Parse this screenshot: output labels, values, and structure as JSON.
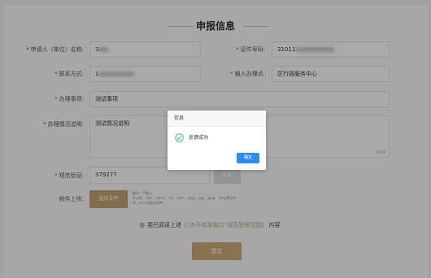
{
  "page": {
    "title": "申报信息"
  },
  "form": {
    "applicant": {
      "label": "申请人（单位）名称:",
      "value": "3"
    },
    "cert_no": {
      "label": "证件号码:",
      "value": "31011"
    },
    "contact": {
      "label": "联系方式:",
      "value": "1"
    },
    "location": {
      "label": "输入办理点:",
      "value": "区行政服务中心"
    },
    "matter": {
      "label": "办理事项:",
      "value": "测试事项"
    },
    "description": {
      "label": "办理情况说明:",
      "value": "测试情况说明",
      "counter": "6/300"
    },
    "sms": {
      "label": "短信验证:",
      "value": "379277",
      "send_button": "获取"
    },
    "upload": {
      "label": "附件上传:",
      "button": "选择文件",
      "note": "备注：只能上传.pdf、.doc、.docx、.xls、.xlsx、.png、.jpg、.jpeg、.bmp格式文件，大小不超过10M"
    },
    "agreement": {
      "prefix": "我已阅读上述",
      "link": "《“办不成事窗口”规范受理范围》",
      "suffix": "内容"
    },
    "submit": "提交"
  },
  "dialog": {
    "title": "信息",
    "message": "反馈成功",
    "confirm": "确定",
    "accent_color": "#2d8cf0",
    "icon": "check-circle-icon"
  },
  "colors": {
    "gold": "#c0a171",
    "required": "#d0342c"
  }
}
